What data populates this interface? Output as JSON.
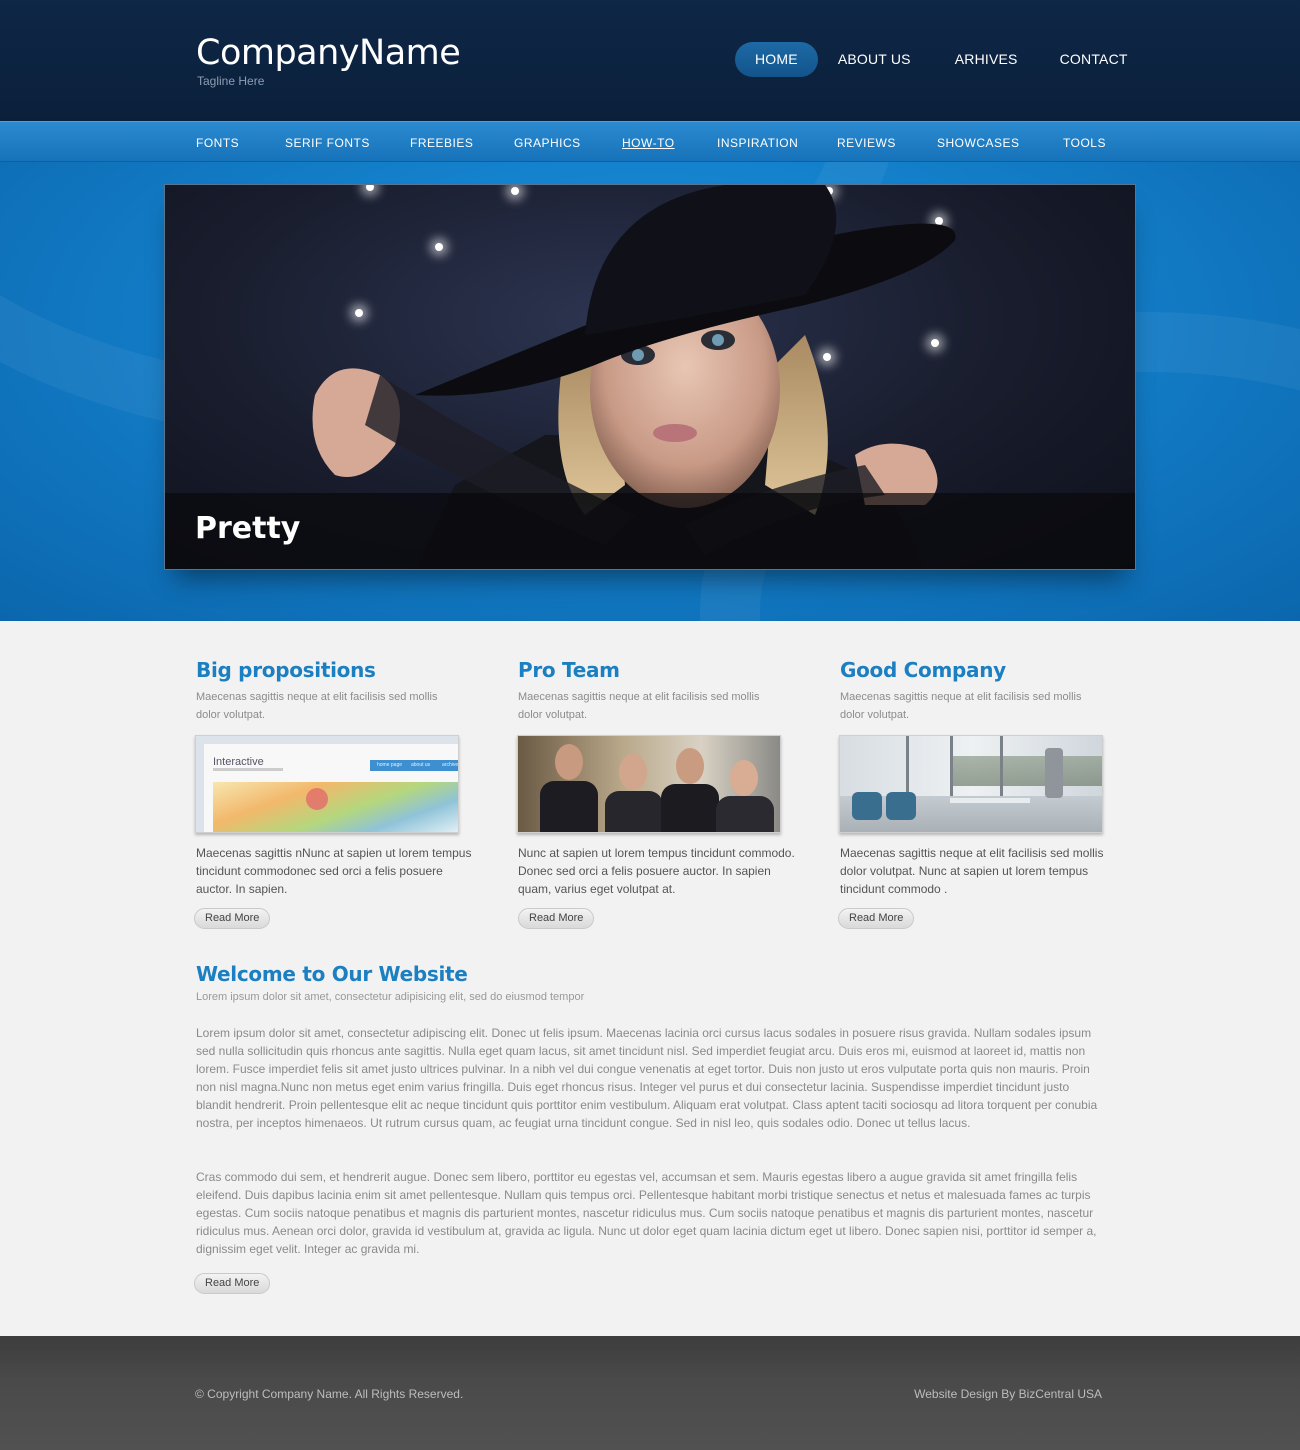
{
  "header": {
    "logo": "CompanyName",
    "tagline": "Tagline Here",
    "nav": [
      "HOME",
      "ABOUT US",
      "ARHIVES",
      "CONTACT"
    ]
  },
  "subnav": [
    "FONTS",
    "SERIF FONTS",
    "FREEBIES",
    "GRAPHICS",
    "HOW-TO",
    "INSPIRATION",
    "REVIEWS",
    "SHOWCASES",
    "TOOLS"
  ],
  "slider": {
    "caption": "Pretty"
  },
  "columns": [
    {
      "title": "Big propositions",
      "subtitle": "Maecenas sagittis neque at elit facilisis sed mollis dolor volutpat.",
      "text": "Maecenas sagittis nNunc at sapien ut lorem tempus tincidunt commodonec sed orci a felis posuere auctor. In sapien.",
      "button": "Read More",
      "thumb": {
        "heading": "Interactive",
        "nav": [
          "home page",
          "about us",
          "archives"
        ]
      }
    },
    {
      "title": "Pro Team",
      "subtitle": "Maecenas sagittis neque at elit facilisis sed mollis dolor volutpat.",
      "text": "Nunc at sapien ut lorem tempus tincidunt commodo. Donec sed orci a felis posuere auctor. In sapien quam, varius eget volutpat at.",
      "button": "Read More"
    },
    {
      "title": "Good Company",
      "subtitle": "Maecenas sagittis neque at elit facilisis sed mollis dolor volutpat.",
      "text": "Maecenas sagittis neque at elit facilisis sed mollis dolor volutpat. Nunc at sapien ut lorem tempus tincidunt commodo .",
      "button": "Read More"
    }
  ],
  "welcome": {
    "title": "Welcome to Our Website",
    "subtitle": "Lorem ipsum dolor sit amet, consectetur adipisicing elit, sed do eiusmod tempor",
    "paragraphs": [
      "Lorem ipsum dolor sit amet, consectetur adipiscing elit. Donec ut felis ipsum. Maecenas lacinia orci cursus lacus sodales in posuere risus gravida. Nullam sodales ipsum sed nulla sollicitudin quis rhoncus ante sagittis. Nulla eget quam lacus, sit amet tincidunt nisl. Sed imperdiet feugiat arcu. Duis eros mi, euismod at laoreet id, mattis non lorem. Fusce imperdiet felis sit amet justo ultrices pulvinar. In a nibh vel dui congue venenatis at eget tortor. Duis non justo ut eros vulputate porta quis non mauris. Proin non nisl magna.Nunc non metus eget enim varius fringilla. Duis eget rhoncus risus. Integer vel purus et dui consectetur lacinia. Suspendisse imperdiet tincidunt justo blandit hendrerit. Proin pellentesque elit ac neque tincidunt quis porttitor enim vestibulum. Aliquam erat volutpat. Class aptent taciti sociosqu ad litora torquent per conubia nostra, per inceptos himenaeos. Ut rutrum cursus quam, ac feugiat urna tincidunt congue. Sed in nisl leo, quis sodales odio. Donec ut tellus lacus.",
      "Cras commodo dui sem, et hendrerit augue. Donec sem libero, porttitor eu egestas vel, accumsan et sem. Mauris egestas libero a augue gravida sit amet fringilla felis eleifend. Duis dapibus lacinia enim sit amet pellentesque. Nullam quis tempus orci. Pellentesque habitant morbi tristique senectus et netus et malesuada fames ac turpis egestas. Cum sociis natoque penatibus et magnis dis parturient montes, nascetur ridiculus mus. Cum sociis natoque penatibus et magnis dis parturient montes, nascetur ridiculus mus. Aenean orci dolor, gravida id vestibulum at, gravida ac ligula. Nunc ut dolor eget quam lacinia dictum eget ut libero. Donec sapien nisi, porttitor id semper a, dignissim eget velit. Integer ac gravida mi."
    ],
    "button": "Read More"
  },
  "footer": {
    "copyright": "© Copyright Company Name. All Rights Reserved.",
    "credit": "Website Design By BizCentral USA"
  },
  "colors": {
    "header_bg": "#0c2340",
    "accent_blue": "#1b7fc1",
    "subnav_bg": "#1f7fc4",
    "footer_bg": "#474747"
  }
}
